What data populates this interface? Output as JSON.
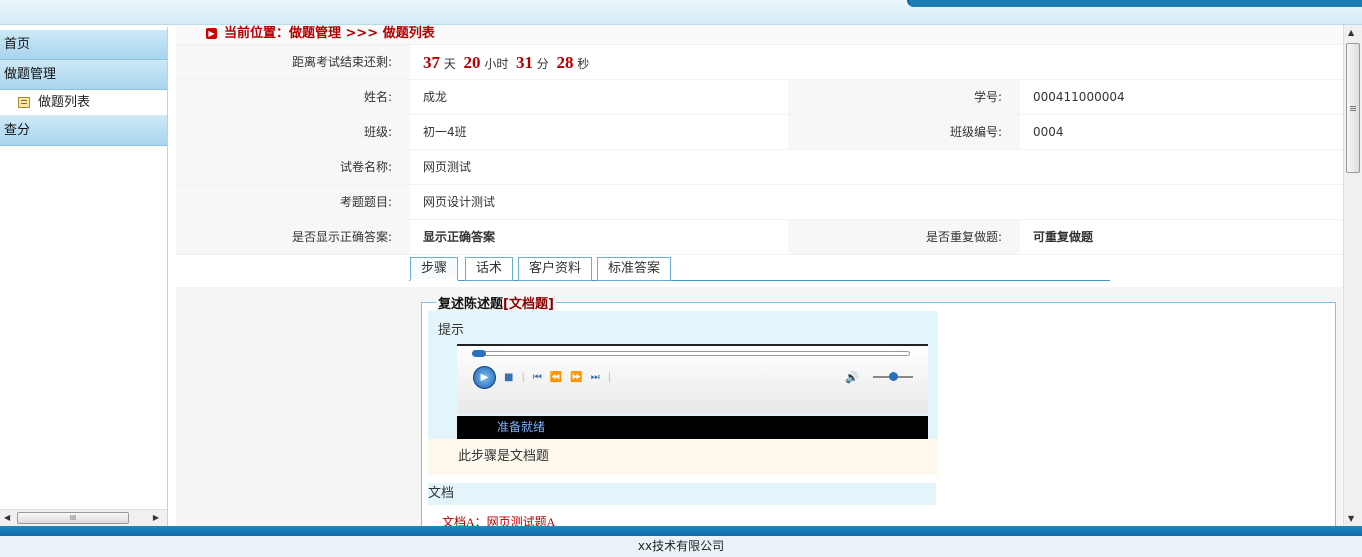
{
  "sidebar": {
    "items": [
      {
        "label": "首页"
      },
      {
        "label": "做题管理"
      },
      {
        "label": "做题列表"
      },
      {
        "label": "查分"
      }
    ],
    "scroll_grip": "III"
  },
  "breadcrumb": "当前位置：做题管理 >>> 做题列表",
  "countdown": {
    "label": "距离考试结束还剩:",
    "days": "37",
    "days_unit": "天",
    "hours": "20",
    "hours_unit": "小时",
    "minutes": "31",
    "minutes_unit": "分",
    "seconds": "28",
    "seconds_unit": "秒"
  },
  "info": {
    "name_label": "姓名:",
    "name": "成龙",
    "student_no_label": "学号:",
    "student_no": "000411000004",
    "class_label": "班级:",
    "class": "初一4班",
    "class_no_label": "班级编号:",
    "class_no": "0004",
    "paper_label": "试卷名称:",
    "paper": "网页测试",
    "topic_label": "考题题目:",
    "topic": "网页设计测试",
    "show_answer_label": "是否显示正确答案:",
    "show_answer": "显示正确答案",
    "repeat_label": "是否重复做题:",
    "repeat": "可重复做题"
  },
  "tabs": [
    {
      "label": "步骤"
    },
    {
      "label": "话术"
    },
    {
      "label": "客户资料"
    },
    {
      "label": "标准答案"
    }
  ],
  "question": {
    "legend": "复述陈述题",
    "legend_type": "[文档题]",
    "hint_label": "提示",
    "player_status": "准备就绪",
    "step_note": "此步骤是文档题",
    "doc_label": "文档",
    "doc_item": "文档A：网页测试题A"
  },
  "footer": "xx技术有限公司"
}
